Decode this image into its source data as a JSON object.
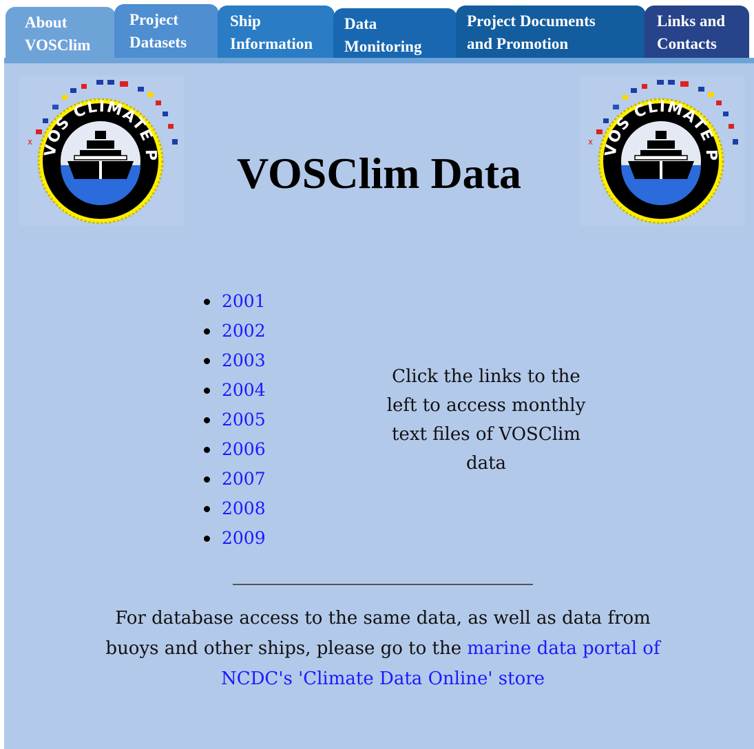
{
  "nav": {
    "tabs": [
      {
        "line1": "About",
        "line2": "VOSClim"
      },
      {
        "line1": "Project",
        "line2": "Datasets"
      },
      {
        "line1": "Ship",
        "line2": "Information"
      },
      {
        "line1": "Data",
        "line2": "Monitoring"
      },
      {
        "line1": "Project Documents",
        "line2": "and Promotion"
      },
      {
        "line1": "Links and",
        "line2": "Contacts"
      }
    ]
  },
  "header": {
    "title": "VOSClim Data",
    "logo_text": "VOS CLIMATE PROJECT"
  },
  "years": [
    "2001",
    "2002",
    "2003",
    "2004",
    "2005",
    "2006",
    "2007",
    "2008",
    "2009"
  ],
  "instructions": "Click the links to the left to access monthly text files of VOSClim data",
  "footer": {
    "text": "For database access to the same data, as well as data from buoys and other ships, please go to the",
    "link_text": "marine data portal of NCDC's 'Climate Data Online' store"
  },
  "colors": {
    "background": "#b3c9ea",
    "link": "#1a1aff",
    "logo_ring": "#ffef00"
  }
}
